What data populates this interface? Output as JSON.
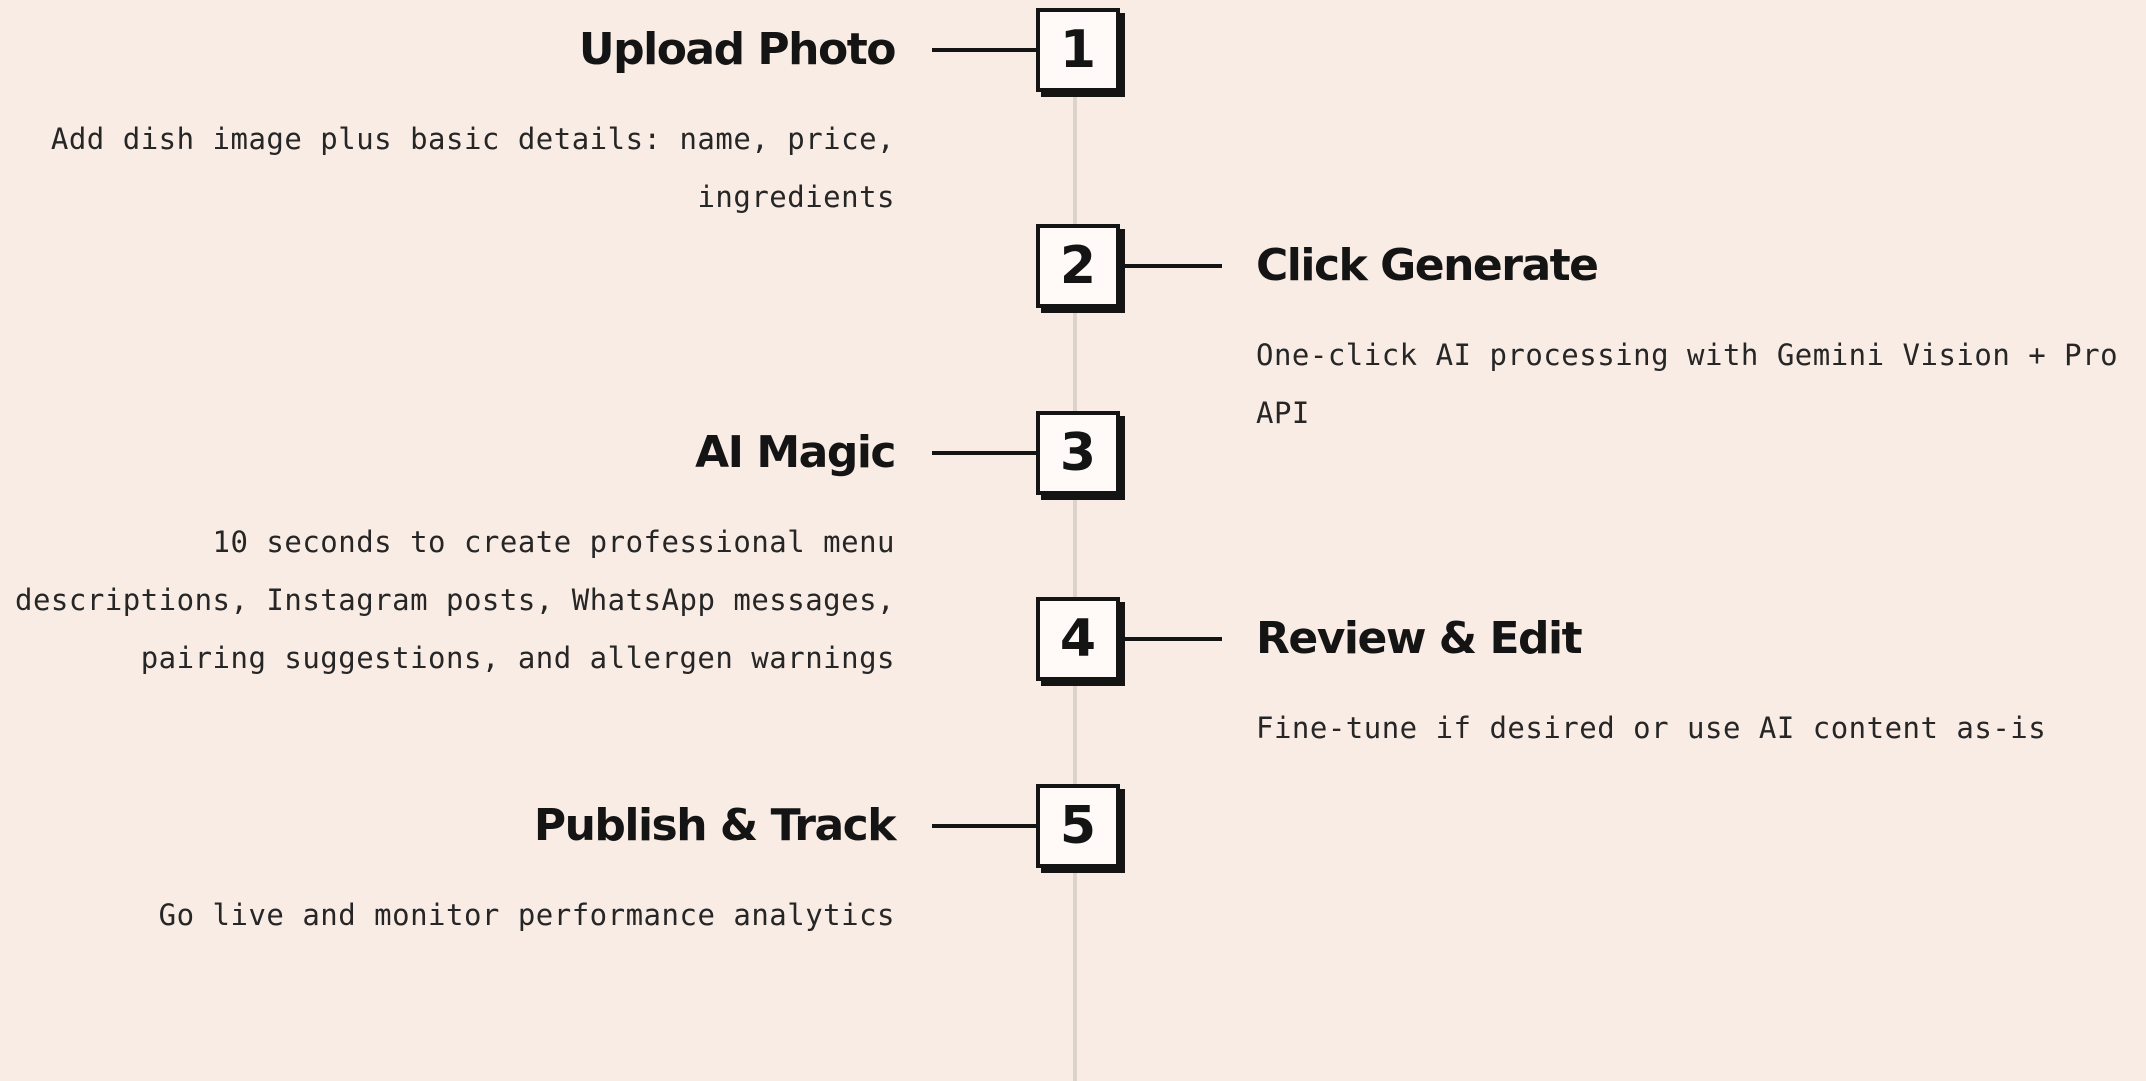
{
  "steps": [
    {
      "number": "1",
      "title": "Upload Photo",
      "description": "Add dish image plus basic details: name, price, ingredients"
    },
    {
      "number": "2",
      "title": "Click Generate",
      "description": "One-click AI processing with Gemini Vision + Pro API"
    },
    {
      "number": "3",
      "title": "AI Magic",
      "description": "10 seconds to create professional menu descriptions, Instagram posts, WhatsApp messages, pairing suggestions, and allergen warnings"
    },
    {
      "number": "4",
      "title": "Review & Edit",
      "description": "Fine-tune if desired or use AI content as-is"
    },
    {
      "number": "5",
      "title": "Publish & Track",
      "description": "Go live and monitor performance analytics"
    }
  ],
  "colors": {
    "background": "#f9ece5",
    "ink": "#141414",
    "spine": "#dcd3cd"
  }
}
